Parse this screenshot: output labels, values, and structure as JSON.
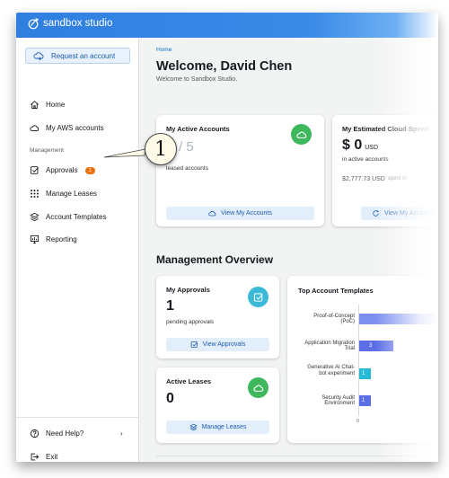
{
  "app": {
    "logo_text": "sandbox studio"
  },
  "sidebar": {
    "request_button": "Request an account",
    "items": [
      {
        "label": "Home",
        "icon": "home-icon"
      },
      {
        "label": "My AWS accounts",
        "icon": "cloud-icon"
      },
      {
        "label": "Approvals",
        "icon": "checkbox-icon",
        "badge": "1"
      },
      {
        "label": "Manage Leases",
        "icon": "grid-dots-icon"
      },
      {
        "label": "Account Templates",
        "icon": "layers-icon"
      },
      {
        "label": "Reporting",
        "icon": "report-icon"
      }
    ],
    "section_label": "Management",
    "help": "Need Help?",
    "exit": "Exit"
  },
  "main": {
    "breadcrumb": "Home",
    "title": "Welcome, David Chen",
    "subtitle": "Welcome to Sandbox Studio.",
    "active_accounts": {
      "title": "My Active Accounts",
      "count": "0",
      "total": "/ 5",
      "caption": "leased accounts",
      "button": "View My Accounts"
    },
    "cloud_spend": {
      "title": "My Estimated Cloud Spend",
      "amount": "$ 0",
      "currency": "USD",
      "caption": "in active accounts",
      "total": "$2,777.73 USD",
      "total_caption": "spent in",
      "button": "View My Accounts"
    },
    "overview_title": "Management Overview",
    "approvals": {
      "title": "My Approvals",
      "count": "1",
      "caption": "pending approvals",
      "button": "View Approvals"
    },
    "leases": {
      "title": "Active Leases",
      "count": "0",
      "button": "Manage Leases"
    },
    "templates_chart_title": "Top Account Templates"
  },
  "chart_data": {
    "type": "bar",
    "orientation": "horizontal",
    "title": "Top Account Templates",
    "categories": [
      "Proof-of-Concept (PoC)",
      "Application Migration Trial",
      "Generative AI Chat-bot experiment",
      "Security Audit Environment"
    ],
    "values": [
      null,
      3,
      1,
      1
    ],
    "value_labels": [
      "",
      "3",
      "1",
      "1"
    ],
    "x_tick_labels": [
      "0"
    ],
    "colors": [
      "#7c8ff0",
      "#5b6ee6",
      "#26bcd6",
      "#5b6ee6"
    ]
  },
  "callout": {
    "number": "1"
  },
  "colors": {
    "accent": "#2f7fe0",
    "badge": "#ec7211",
    "green": "#3db85c",
    "teal": "#3bbad8"
  }
}
